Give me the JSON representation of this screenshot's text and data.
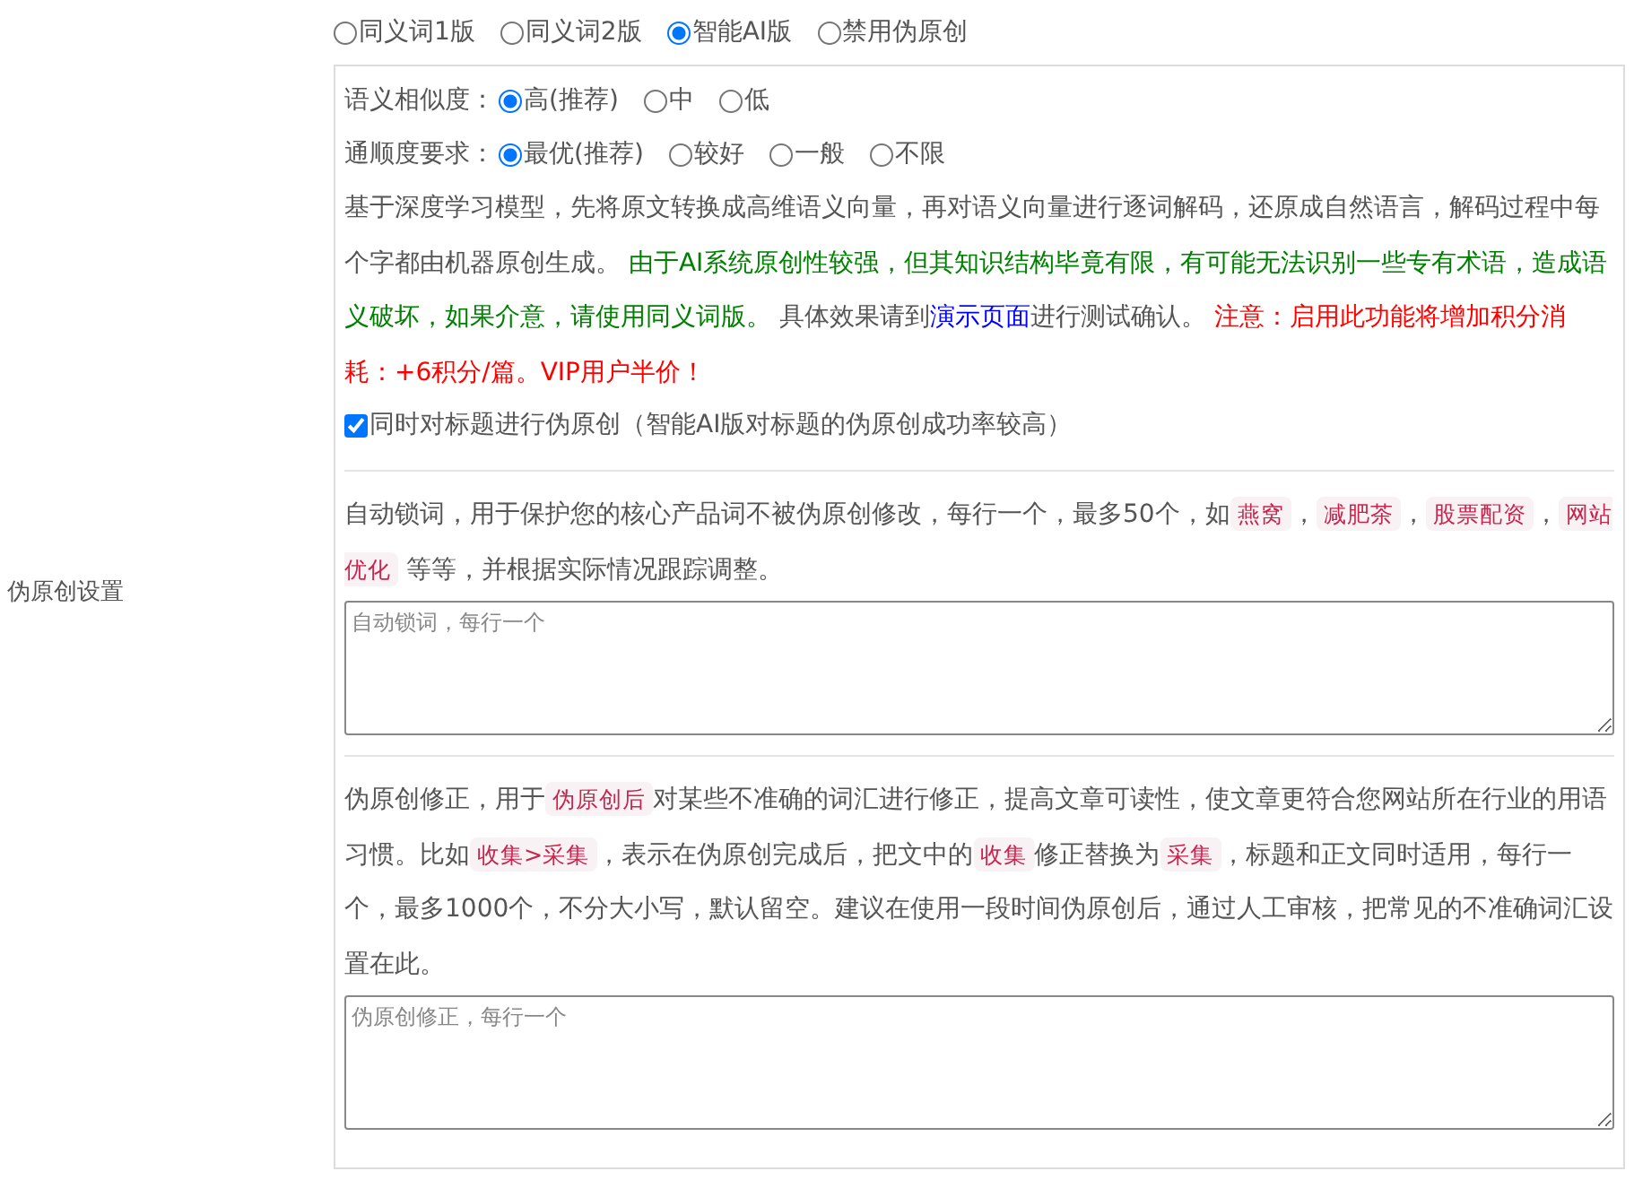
{
  "sidebar_label": "伪原创设置",
  "modes": [
    {
      "label": "同义词1版",
      "selected": false
    },
    {
      "label": "同义词2版",
      "selected": false
    },
    {
      "label": "智能AI版",
      "selected": true
    },
    {
      "label": "禁用伪原创",
      "selected": false
    }
  ],
  "similarity": {
    "label": "语义相似度：",
    "options": [
      {
        "label": "高(推荐)",
        "selected": true
      },
      {
        "label": "中",
        "selected": false
      },
      {
        "label": "低",
        "selected": false
      }
    ]
  },
  "fluency": {
    "label": "通顺度要求：",
    "options": [
      {
        "label": "最优(推荐)",
        "selected": true
      },
      {
        "label": "较好",
        "selected": false
      },
      {
        "label": "一般",
        "selected": false
      },
      {
        "label": "不限",
        "selected": false
      }
    ]
  },
  "description": [
    {
      "kind": "plain",
      "text": "基于深度学习模型，先将原文转换成高维语义向量，再对语义向量进行逐词解码，还原成自然语言，解码过程中每个字都由机器原创生成。 "
    },
    {
      "kind": "green",
      "text": "由于AI系统原创性较强，但其知识结构毕竟有限，有可能无法识别一些专有术语，造成语义破坏，如果介意，请使用同义词版。"
    },
    {
      "kind": "plain",
      "text": " 具体效果请到"
    },
    {
      "kind": "link",
      "text": "演示页面"
    },
    {
      "kind": "plain",
      "text": "进行测试确认。 "
    },
    {
      "kind": "red",
      "text": "注意：启用此功能将增加积分消耗：+6积分/篇。VIP用户半价！"
    }
  ],
  "title_option": {
    "label": "同时对标题进行伪原创（智能AI版对标题的伪原创成功率较高）",
    "checked": true
  },
  "lock_words": {
    "description": [
      {
        "kind": "plain",
        "text": "自动锁词，用于保护您的核心产品词不被伪原创修改，每行一个，最多50个，如"
      },
      {
        "kind": "code",
        "text": "燕窝"
      },
      {
        "kind": "plain",
        "text": "，"
      },
      {
        "kind": "code",
        "text": "减肥茶"
      },
      {
        "kind": "plain",
        "text": "，"
      },
      {
        "kind": "code",
        "text": "股票配资"
      },
      {
        "kind": "plain",
        "text": "，"
      },
      {
        "kind": "code",
        "text": "网站优化"
      },
      {
        "kind": "plain",
        "text": " 等等，并根据实际情况跟踪调整。"
      }
    ],
    "placeholder": "自动锁词，每行一个"
  },
  "corrections": {
    "description": [
      {
        "kind": "plain",
        "text": "伪原创修正，用于"
      },
      {
        "kind": "code",
        "text": "伪原创后"
      },
      {
        "kind": "plain",
        "text": "对某些不准确的词汇进行修正，提高文章可读性，使文章更符合您网站所在行业的用语习惯。比如"
      },
      {
        "kind": "code",
        "text": "收集>采集"
      },
      {
        "kind": "plain",
        "text": "，表示在伪原创完成后，把文中的"
      },
      {
        "kind": "code",
        "text": "收集"
      },
      {
        "kind": "plain",
        "text": "修正替换为"
      },
      {
        "kind": "code",
        "text": "采集"
      },
      {
        "kind": "plain",
        "text": "，标题和正文同时适用，每行一个，最多1000个，不分大小写，默认留空。建议在使用一段时间伪原创后，通过人工审核，把常见的不准确词汇设置在此。"
      }
    ],
    "placeholder": "伪原创修正，每行一个"
  }
}
